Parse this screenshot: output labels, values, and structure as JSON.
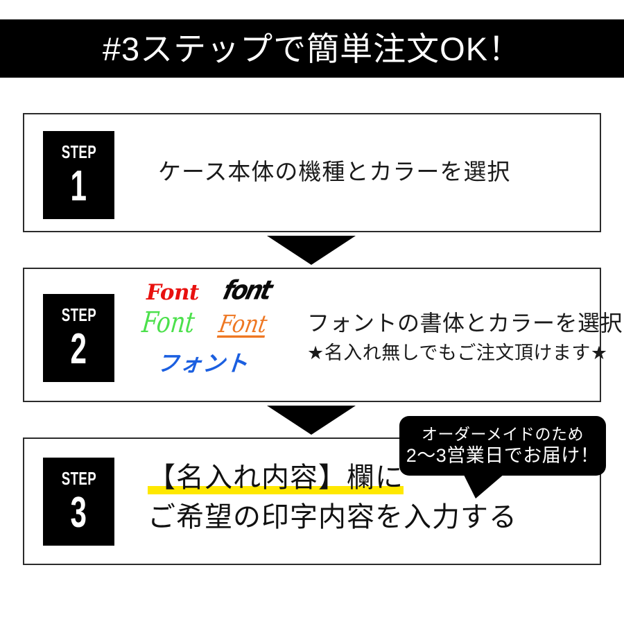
{
  "header": {
    "title": "#3ステップで簡単注文OK！"
  },
  "steps": [
    {
      "badge_word": "STEP",
      "badge_number": "1",
      "text": "ケース本体の機種とカラーを選択"
    },
    {
      "badge_word": "STEP",
      "badge_number": "2",
      "line1": "フォントの書体とカラーを選択",
      "line2": "★名入れ無しでもご注文頂けます★",
      "font_samples": [
        {
          "label": "Font",
          "color": "#e8110f",
          "style": "bold-italic-serif"
        },
        {
          "label": "font",
          "color": "#0a0a0a",
          "style": "heavy-slanted-block"
        },
        {
          "label": "Font",
          "color": "#4ce04c",
          "style": "handwritten-script"
        },
        {
          "label": "Font",
          "color": "#ee7722",
          "style": "cursive-underlined"
        },
        {
          "label": "フォント",
          "color": "#1b5fe0",
          "style": "brush-katakana"
        }
      ]
    },
    {
      "badge_word": "STEP",
      "badge_number": "3",
      "line1": "【名入れ内容】欄に",
      "line2": "ご希望の印字内容を入力する",
      "highlight_color": "#ffe800"
    }
  ],
  "bubble": {
    "line1": "オーダーメイドのため",
    "line2": "2〜3営業日でお届け！"
  },
  "colors": {
    "banner_bg": "#000000",
    "banner_text": "#ffffff",
    "box_border": "#2b2b2b",
    "badge_bg": "#000000",
    "highlight": "#ffe800",
    "page_bg": "#ffffff"
  }
}
